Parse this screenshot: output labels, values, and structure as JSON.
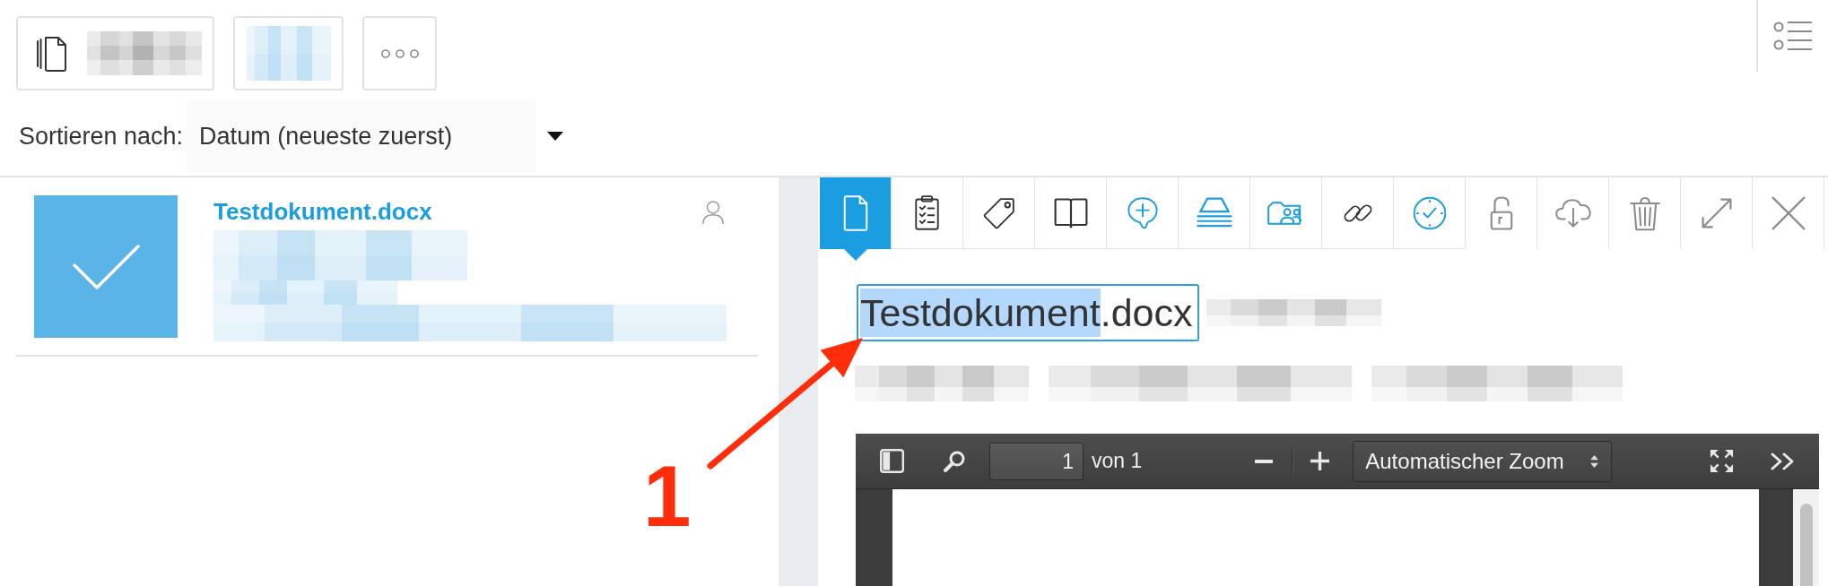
{
  "toolbar": {
    "buttons": [
      {
        "kind": "document"
      },
      {
        "kind": "plain"
      },
      {
        "kind": "more"
      }
    ]
  },
  "sort": {
    "label": "Sortieren nach:",
    "value": "Datum (neueste zuerst)"
  },
  "documents": [
    {
      "title": "Testdokument.docx",
      "selected": true
    }
  ],
  "detail": {
    "tabs": [
      {
        "kind": "tab",
        "selected": true,
        "highlighted": false
      },
      {
        "kind": "tab",
        "selected": false,
        "highlighted": false
      },
      {
        "kind": "tab",
        "selected": false,
        "highlighted": false
      },
      {
        "kind": "tab",
        "selected": false,
        "highlighted": false
      },
      {
        "kind": "tab",
        "selected": false,
        "highlighted": true
      },
      {
        "kind": "tab",
        "selected": false,
        "highlighted": true
      },
      {
        "kind": "tab",
        "selected": false,
        "highlighted": true
      },
      {
        "kind": "tab",
        "selected": false,
        "highlighted": false
      },
      {
        "kind": "tab",
        "selected": false,
        "highlighted": true
      },
      {
        "kind": "action",
        "selected": false,
        "highlighted": false
      },
      {
        "kind": "action",
        "selected": false,
        "highlighted": false
      },
      {
        "kind": "action",
        "selected": false,
        "highlighted": false
      },
      {
        "kind": "action",
        "selected": false,
        "highlighted": false
      },
      {
        "kind": "action",
        "selected": false,
        "highlighted": false
      }
    ],
    "title_field": {
      "selected_text": "Testdokument",
      "rest_text": ".docx",
      "focused": true
    },
    "pdf_viewer": {
      "page": "1",
      "page_total": "von 1",
      "zoom": "Automatischer Zoom"
    }
  },
  "annotation": {
    "label": "1"
  }
}
